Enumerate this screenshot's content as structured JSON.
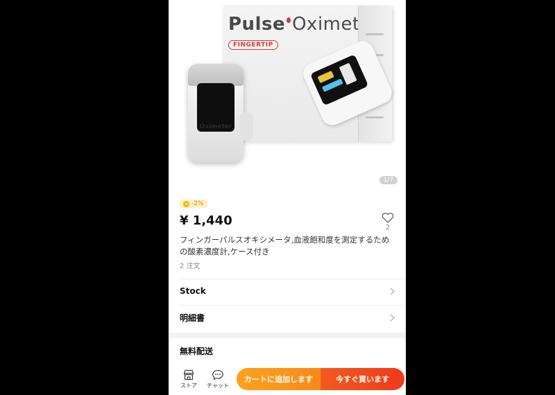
{
  "product_image": {
    "box_brand_part1": "Pulse",
    "box_brand_part2": "Oximeter",
    "box_badge": "FINGERTIP",
    "device_label": "Oximeter",
    "counter": "1/7"
  },
  "price_section": {
    "discount_badge": "-2%",
    "price": "¥ 1,440",
    "favorite_count": "2",
    "title": "フィンガーパルスオキシメータ,血液飽和度を測定するための酸素濃度計,ケース付き",
    "orders": "2 注文"
  },
  "rows": {
    "stock_label": "Stock",
    "spec_label": "明細書"
  },
  "shipping": {
    "label": "無料配送"
  },
  "bottom_bar": {
    "store_label": "ストア",
    "chat_label": "チャット",
    "add_to_cart_label": "カートに追加します",
    "buy_now_label": "今すぐ買います"
  },
  "colors": {
    "page_background": "#000000",
    "cart_button": "#f9921b",
    "buy_button": "#ef451d",
    "discount_badge_bg": "#fff1c4",
    "discount_badge_text": "#d08a00"
  }
}
